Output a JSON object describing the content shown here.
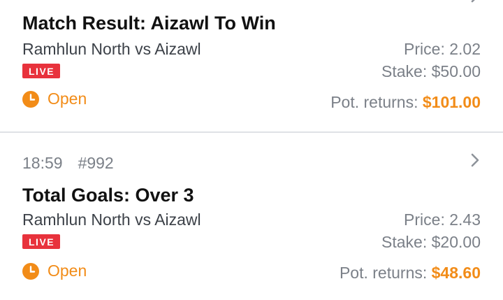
{
  "bets": [
    {
      "title": "Match Result: Aizawl To Win",
      "match": "Ramhlun North vs Aizawl",
      "badge": "LIVE",
      "status": "Open",
      "price_label": "Price:",
      "price_value": "2.02",
      "stake_label": "Stake:",
      "stake_value": "$50.00",
      "returns_label": "Pot. returns:",
      "returns_value": "$101.00"
    },
    {
      "time": "18:59",
      "ref": "#992",
      "title": "Total Goals: Over 3",
      "match": "Ramhlun North vs Aizawl",
      "badge": "LIVE",
      "status": "Open",
      "price_label": "Price:",
      "price_value": "2.43",
      "stake_label": "Stake:",
      "stake_value": "$20.00",
      "returns_label": "Pot. returns:",
      "returns_value": "$48.60"
    }
  ],
  "icons": {
    "status": "clock-icon",
    "expand": "chevron-right-icon"
  },
  "colors": {
    "accent": "#f28c18",
    "live": "#e8323c",
    "divider": "#dfe2e6"
  }
}
